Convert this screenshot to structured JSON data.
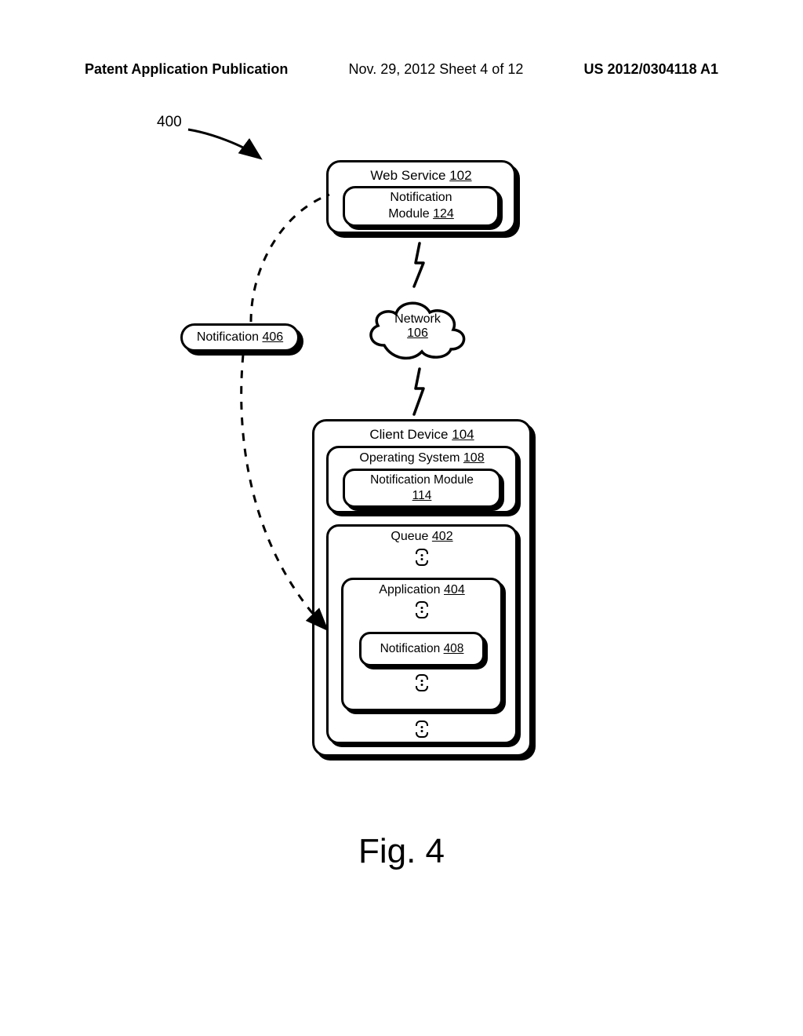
{
  "header": {
    "left": "Patent Application Publication",
    "middle": "Nov. 29, 2012  Sheet 4 of 12",
    "right": "US 2012/0304118 A1"
  },
  "ref400": "400",
  "web_service": {
    "title": "Web Service",
    "num": "102"
  },
  "notif124": {
    "label": "Notification\nModule",
    "num": "124"
  },
  "network": {
    "label": "Network",
    "num": "106"
  },
  "notif406": {
    "label": "Notification",
    "num": "406"
  },
  "client_device": {
    "title": "Client Device",
    "num": "104"
  },
  "os": {
    "title": "Operating System",
    "num": "108"
  },
  "nm114": {
    "label": "Notification Module",
    "num": "114"
  },
  "queue": {
    "title": "Queue",
    "num": "402"
  },
  "app": {
    "title": "Application",
    "num": "404"
  },
  "notif408": {
    "label": "Notification",
    "num": "408"
  },
  "figure": "Fig. 4"
}
